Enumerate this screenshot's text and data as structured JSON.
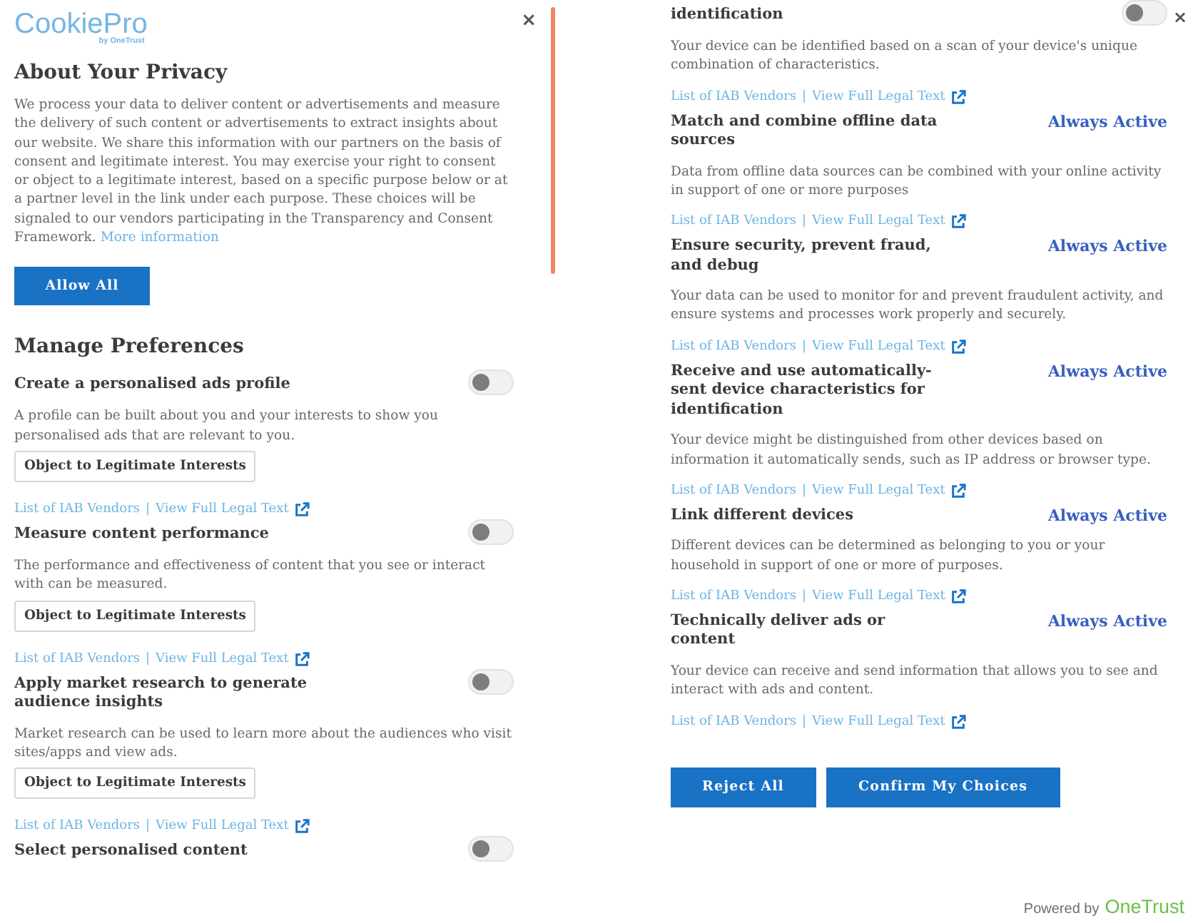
{
  "left_panel": {
    "logo": {
      "name": "CookiePro",
      "byline": "by OneTrust"
    },
    "close": "×",
    "title": "About Your Privacy",
    "description": "We process your data to deliver content or advertisements and measure the delivery of such content or advertisements to extract insights about our website. We share this information with our partners on the basis of consent and legitimate interest. You may exercise your right to consent or object to a legitimate interest, based on a specific purpose below or at a partner level in the link under each purpose. These choices will be signaled to our vendors participating in the Transparency and Consent Framework.",
    "more_link": "More information",
    "allow_button": "Allow All",
    "preferences_title": "Manage Preferences",
    "purposes": [
      {
        "kind": "toggle",
        "title": "Create a personalised ads profile",
        "on": false,
        "description": "A profile can be built about you and your interests to show you personalised ads that are relevant to you.",
        "object_button": "Object to Legitimate Interests",
        "vendors_link": "List of IAB Vendors",
        "separator": "|",
        "legal_link": "View Full Legal Text"
      },
      {
        "kind": "toggle",
        "title": "Measure content performance",
        "on": false,
        "description": "The performance and effectiveness of content that you see or interact with can be measured.",
        "object_button": "Object to Legitimate Interests",
        "vendors_link": "List of IAB Vendors",
        "separator": "|",
        "legal_link": "View Full Legal Text"
      },
      {
        "kind": "toggle",
        "title": "Apply market research to generate audience insights",
        "on": false,
        "description": "Market research can be used to learn more about the audiences who visit sites/apps and view ads.",
        "object_button": "Object to Legitimate Interests",
        "vendors_link": "List of IAB Vendors",
        "separator": "|",
        "legal_link": "View Full Legal Text"
      },
      {
        "kind": "toggle",
        "title": "Select personalised content",
        "on": false
      }
    ]
  },
  "right_panel": {
    "close": "×",
    "purposes": [
      {
        "kind": "toggle",
        "title": "identification",
        "on": false,
        "description": "Your device can be identified based on a scan of your device's unique combination of characteristics.",
        "vendors_link": "List of IAB Vendors",
        "separator": "|",
        "legal_link": "View Full Legal Text"
      },
      {
        "kind": "always_active",
        "title": "Match and combine offline data sources",
        "status": "Always Active",
        "description": "Data from offline data sources can be combined with your online activity in support of one or more purposes",
        "vendors_link": "List of IAB Vendors",
        "separator": "|",
        "legal_link": "View Full Legal Text"
      },
      {
        "kind": "always_active",
        "title": "Ensure security, prevent fraud, and debug",
        "status": "Always Active",
        "description": "Your data can be used to monitor for and prevent fraudulent activity, and ensure systems and processes work properly and securely.",
        "vendors_link": "List of IAB Vendors",
        "separator": "|",
        "legal_link": "View Full Legal Text"
      },
      {
        "kind": "always_active",
        "title": "Receive and use automatically-sent device characteristics for identification",
        "status": "Always Active",
        "description": "Your device might be distinguished from other devices based on information it automatically sends, such as IP address or browser type.",
        "vendors_link": "List of IAB Vendors",
        "separator": "|",
        "legal_link": "View Full Legal Text"
      },
      {
        "kind": "always_active",
        "title": "Link different devices",
        "status": "Always Active",
        "description": "Different devices can be determined as belonging to you or your household in support of one or more of purposes.",
        "vendors_link": "List of IAB Vendors",
        "separator": "|",
        "legal_link": "View Full Legal Text"
      },
      {
        "kind": "always_active",
        "title": "Technically deliver ads or content",
        "status": "Always Active",
        "description": "Your device can receive and send information that allows you to see and interact with ads and content.",
        "vendors_link": "List of IAB Vendors",
        "separator": "|",
        "legal_link": "View Full Legal Text"
      }
    ],
    "buttons": [
      {
        "label": "Reject All"
      },
      {
        "label": "Confirm My Choices"
      }
    ],
    "footer": {
      "powered_by": "Powered by",
      "brand": "OneTrust"
    }
  }
}
